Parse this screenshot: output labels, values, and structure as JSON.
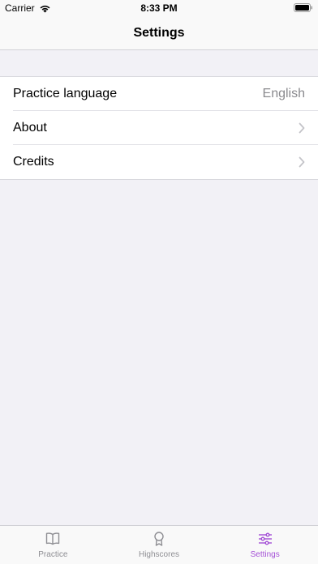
{
  "status_bar": {
    "carrier": "Carrier",
    "time": "8:33 PM"
  },
  "nav": {
    "title": "Settings"
  },
  "settings": {
    "rows": [
      {
        "label": "Practice language",
        "value": "English"
      },
      {
        "label": "About",
        "value": ""
      },
      {
        "label": "Credits",
        "value": ""
      }
    ]
  },
  "tab_bar": {
    "accent": "#a44fd6",
    "inactive": "#8e8e93",
    "tabs": [
      {
        "label": "Practice",
        "icon": "book-icon"
      },
      {
        "label": "Highscores",
        "icon": "award-icon"
      },
      {
        "label": "Settings",
        "icon": "sliders-icon",
        "selected": true
      }
    ]
  }
}
